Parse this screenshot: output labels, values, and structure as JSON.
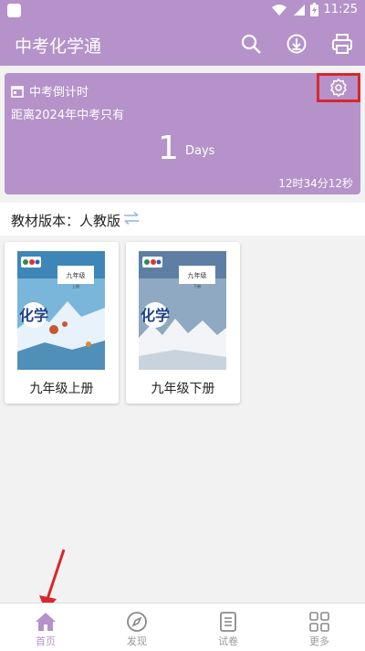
{
  "status": {
    "time": "11:25"
  },
  "appbar": {
    "title": "中考化学通"
  },
  "countdown": {
    "header": "中考倒计时",
    "subtitle": "距离2024年中考只有",
    "days_value": "1",
    "days_unit": "Days",
    "remaining_time": "12时34分12秒"
  },
  "edition": {
    "label": "教材版本：人教版"
  },
  "books": [
    {
      "name": "九年级上册",
      "cover_title": "化学",
      "cover_grade": "九年级",
      "cover_vol": "上册"
    },
    {
      "name": "九年级下册",
      "cover_title": "化学",
      "cover_grade": "九年级",
      "cover_vol": "下册"
    }
  ],
  "nav": [
    {
      "label": "首页"
    },
    {
      "label": "发现"
    },
    {
      "label": "试卷"
    },
    {
      "label": "更多"
    }
  ],
  "colors": {
    "primary": "#b592c9",
    "highlight": "#d9262d"
  }
}
